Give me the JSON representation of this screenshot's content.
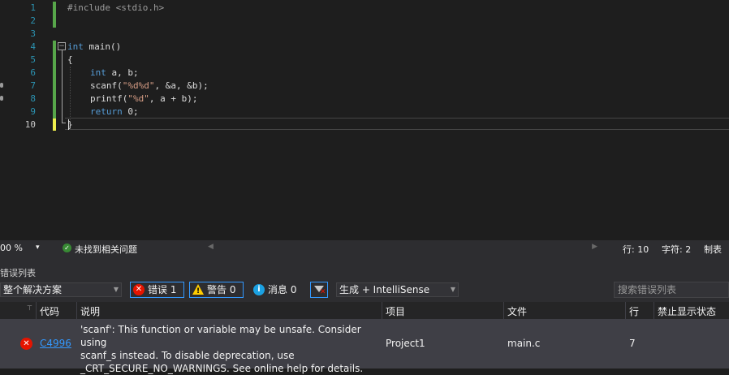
{
  "editor": {
    "line_numbers": [
      "1",
      "2",
      "3",
      "4",
      "5",
      "6",
      "7",
      "8",
      "9",
      "10"
    ],
    "code": {
      "l1": "#include <stdio.h>",
      "l4_kw": "int",
      "l4_rest": " main()",
      "l5": "{",
      "l6_kw": "int",
      "l6_rest": " a, b;",
      "l7_a": "scanf(",
      "l7_str": "\"%d%d\"",
      "l7_b": ", &a, &b);",
      "l8_a": "printf(",
      "l8_str": "\"%d\"",
      "l8_b": ", a + b);",
      "l9_kw": "return",
      "l9_rest": " 0;",
      "l10": "}"
    }
  },
  "status_bar": {
    "zoom": "00 %",
    "zoom_arrow": "▾",
    "issues": "未找到相关问题",
    "line": "行: 10",
    "char": "字符: 2",
    "tab": "制表符"
  },
  "error_list": {
    "title": "错误列表",
    "scope": "整个解决方案",
    "errors_label": "错误 1",
    "warnings_label": "警告 0",
    "messages_label": "消息 0",
    "build_filter": "生成 + IntelliSense",
    "search_placeholder": "搜索错误列表",
    "columns": {
      "code": "代码",
      "description": "说明",
      "project": "项目",
      "file": "文件",
      "line": "行",
      "suppression": "禁止显示状态"
    },
    "rows": [
      {
        "code": "C4996",
        "description_lines": [
          "'scanf': This function or variable may be unsafe. Consider using",
          "scanf_s instead. To disable deprecation, use",
          "_CRT_SECURE_NO_WARNINGS. See online help for details."
        ],
        "project": "Project1",
        "file": "main.c",
        "line": "7",
        "suppression": ""
      }
    ]
  },
  "colors": {
    "editor_bg": "#1e1e1e",
    "keyword": "#569cd6",
    "string": "#d69d85",
    "line_number": "#2b91af",
    "error": "#e51400",
    "accent": "#3399ff"
  },
  "icons": {
    "ok": "check-circle-icon",
    "error": "error-circle-icon",
    "warning": "warning-triangle-icon",
    "info": "info-circle-icon",
    "filter": "filter-icon"
  }
}
